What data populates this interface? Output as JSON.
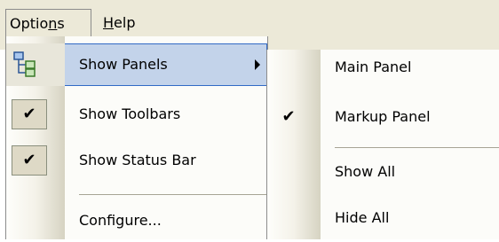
{
  "menubar": {
    "options": {
      "prefix": "Optio",
      "mnemonic": "n",
      "suffix": "s"
    },
    "help": {
      "mnemonic": "H",
      "suffix": "elp"
    }
  },
  "options_menu": {
    "items": [
      {
        "label": "Show Panels",
        "icon": "panels-tree-icon",
        "has_submenu": true,
        "highlighted": true
      },
      {
        "label": "Show Toolbars",
        "checked": true
      },
      {
        "label": "Show Status Bar",
        "checked": true
      },
      {
        "label": "Configure...",
        "separator_before": true
      }
    ]
  },
  "show_panels_submenu": {
    "items": [
      {
        "label": "Main Panel",
        "checked": false
      },
      {
        "label": "Markup Panel",
        "checked": true
      },
      {
        "label": "Show All",
        "separator_before": true
      },
      {
        "label": "Hide All"
      }
    ]
  },
  "glyphs": {
    "check": "✔"
  },
  "colors": {
    "highlight": "#c3d3ea",
    "highlight_border": "#316ac5",
    "menubar": "#ece9d8"
  }
}
